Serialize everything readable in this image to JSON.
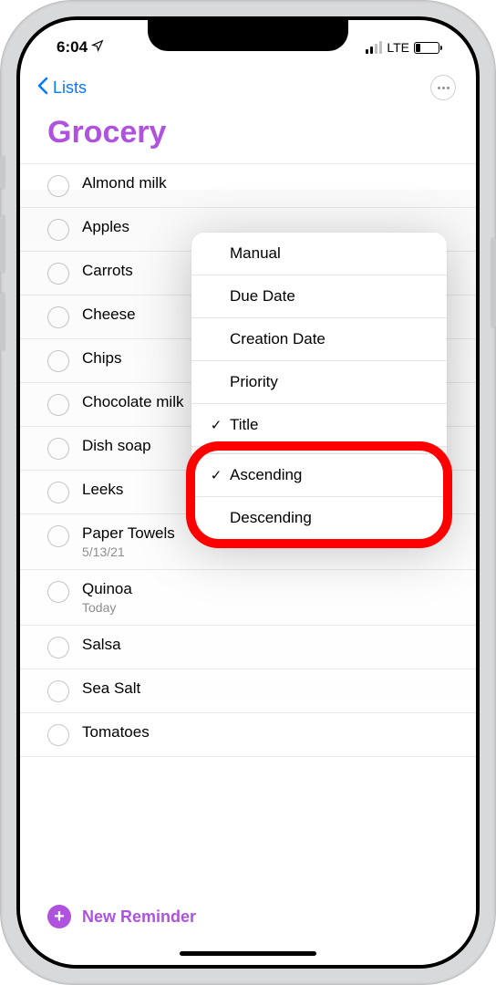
{
  "status": {
    "time": "6:04",
    "network_label": "LTE"
  },
  "nav": {
    "back_label": "Lists"
  },
  "list": {
    "title": "Grocery",
    "accent_color": "#af52de",
    "items": [
      {
        "title": "Almond milk",
        "sub": null
      },
      {
        "title": "Apples",
        "sub": null
      },
      {
        "title": "Carrots",
        "sub": null
      },
      {
        "title": "Cheese",
        "sub": null
      },
      {
        "title": "Chips",
        "sub": null
      },
      {
        "title": "Chocolate milk",
        "sub": null
      },
      {
        "title": "Dish soap",
        "sub": null
      },
      {
        "title": "Leeks",
        "sub": null
      },
      {
        "title": "Paper Towels",
        "sub": "5/13/21"
      },
      {
        "title": "Quinoa",
        "sub": "Today"
      },
      {
        "title": "Salsa",
        "sub": null
      },
      {
        "title": "Sea Salt",
        "sub": null
      },
      {
        "title": "Tomatoes",
        "sub": null
      }
    ]
  },
  "sort_menu": {
    "sort_by": [
      {
        "label": "Manual",
        "checked": false
      },
      {
        "label": "Due Date",
        "checked": false
      },
      {
        "label": "Creation Date",
        "checked": false
      },
      {
        "label": "Priority",
        "checked": false
      },
      {
        "label": "Title",
        "checked": true
      }
    ],
    "direction": [
      {
        "label": "Ascending",
        "checked": true
      },
      {
        "label": "Descending",
        "checked": false
      }
    ]
  },
  "footer": {
    "new_reminder_label": "New Reminder"
  },
  "annotation": {
    "highlight_target": "sort-direction-section",
    "highlight_color": "#ff0000"
  }
}
